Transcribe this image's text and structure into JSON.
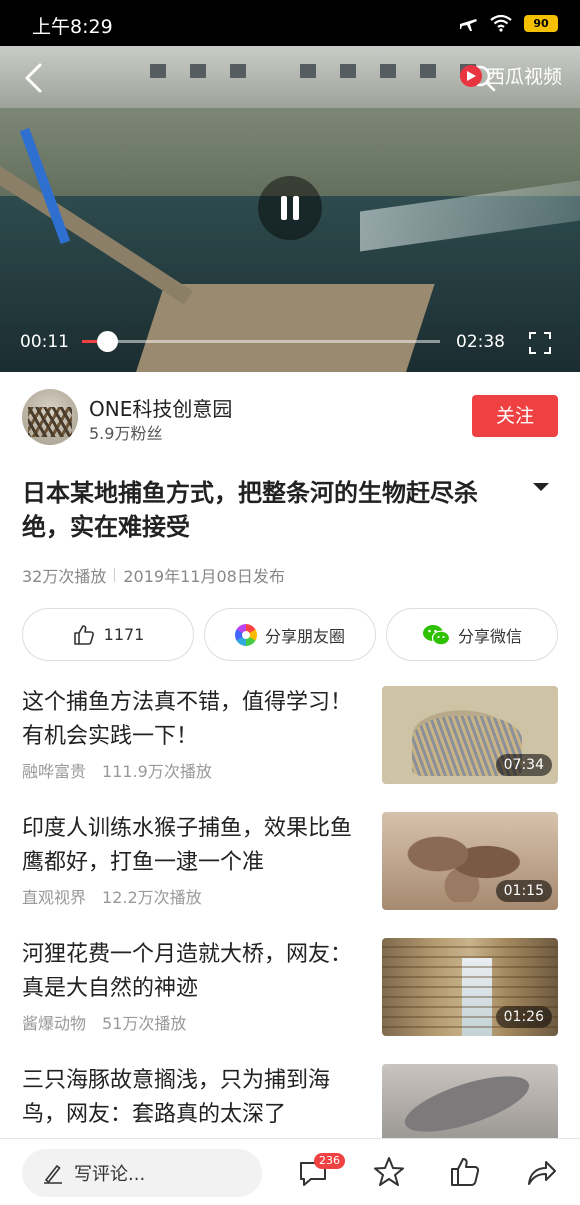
{
  "status_bar": {
    "time": "上午8:29",
    "battery": "90"
  },
  "video": {
    "brand": "西瓜视频",
    "current_time": "00:11",
    "duration": "02:38",
    "progress": 0.07
  },
  "author": {
    "name": "ONE科技创意园",
    "fans": "5.9万粉丝",
    "follow_label": "关注"
  },
  "article": {
    "title": "日本某地捕鱼方式，把整条河的生物赶尽杀绝，实在难接受",
    "plays": "32万次播放",
    "date": "2019年11月08日发布"
  },
  "actions": {
    "like_count": "1171",
    "share_moments": "分享朋友圈",
    "share_wechat": "分享微信"
  },
  "related": [
    {
      "title": "这个捕鱼方法真不错，值得学习！有机会实践一下！",
      "source": "融哗富贵",
      "plays": "111.9万次播放",
      "duration": "07:34"
    },
    {
      "title": "印度人训练水猴子捕鱼，效果比鱼鹰都好，打鱼一逮一个准",
      "source": "直观视界",
      "plays": "12.2万次播放",
      "duration": "01:15"
    },
    {
      "title": "河狸花费一个月造就大桥，网友：真是大自然的神迹",
      "source": "酱爆动物",
      "plays": "51万次播放",
      "duration": "01:26"
    },
    {
      "title": "三只海豚故意搁浅，只为捕到海鸟，网友：套路真的太深了",
      "source": "",
      "plays": "",
      "duration": ""
    }
  ],
  "bottom_bar": {
    "comment_placeholder": "写评论...",
    "comment_count": "236"
  },
  "colors": {
    "accent": "#f04142",
    "wechat": "#2dc100"
  }
}
